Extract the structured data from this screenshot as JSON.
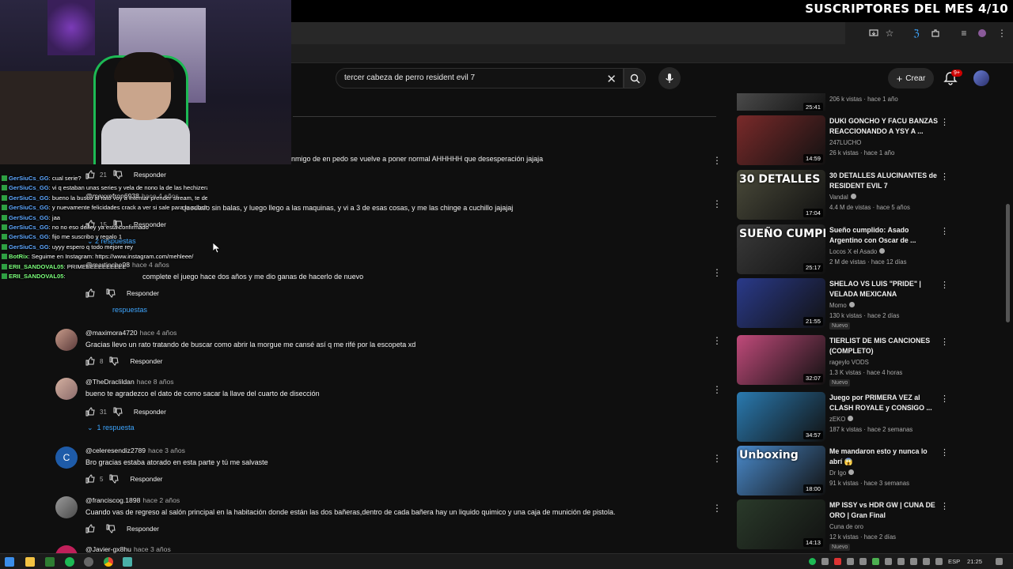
{
  "overlay": {
    "title": "SUSCRIPTORES DEL MES 4/10"
  },
  "search": {
    "query": "tercer cabeza de perro resident evil 7",
    "placeholder": "Buscar"
  },
  "header": {
    "create_label": "Crear",
    "notif_badge": "9+"
  },
  "chat": [
    {
      "user": "GerSiuCs_GG",
      "text": ": cual serie?"
    },
    {
      "user": "GerSiuCs_GG",
      "text": ": vi q estaban unas series y vela de nono la de las hechizeras y la de la n nera"
    },
    {
      "user": "GerSiuCs_GG",
      "text": ": bueno la busco al rato voy a intentar prender stream, te dejo la view"
    },
    {
      "user": "GerSiuCs_GG",
      "text": ": y nuevamente felicidades crack a ver si sale para la subsita"
    },
    {
      "user": "GerSiuCs_GG",
      "text": ": jaa"
    },
    {
      "user": "GerSiuCs_GG",
      "text": ": no no eso de ley ya esta confirmado"
    },
    {
      "user": "GerSiuCs_GG",
      "text": ": fijo me suscribo y regalo 1"
    },
    {
      "user": "GerSiuCs_GG",
      "text": ": uyyy espero q todo mejore rey"
    },
    {
      "user": "BotRix",
      "text": ": Seguime en Instagram: https://www.instagram.com/mehleee/"
    },
    {
      "user": "ERII_SANDOVAL05",
      "text": ": PRIMEEEEEEEEEEE"
    },
    {
      "user": "ERII_SANDOVAL05",
      "text": ":"
    }
  ],
  "comments": [
    {
      "author": "",
      "time": "",
      "text": "nmigo de en pedo se vuelve a poner normal AHHHHH que desesperación jajaja",
      "likes": "21",
      "reply": "Responder"
    },
    {
      "author": "@maxxefron6938",
      "time": "hace 4 años",
      "text": "quedado sin balas, y luego llego a las maquinas, y vi a 3 de esas cosas, y me las chinge a cuchillo jajajaj",
      "likes": "15",
      "reply": "Responder",
      "replies": "2 respuestas"
    },
    {
      "author": "@martincho98",
      "time": "hace 4 años",
      "text": "complete el juego hace dos años y me dio ganas de hacerlo de nuevo",
      "likes": "",
      "reply": "Responder",
      "replies": "respuestas"
    },
    {
      "author": "@maximora4720",
      "time": "hace 4 años",
      "text": "Gracias llevo un rato tratando de buscar como abrir la morgue me cansé así q me rifé por la escopeta xd",
      "likes": "8",
      "reply": "Responder"
    },
    {
      "author": "@TheDraclildan",
      "time": "hace 8 años",
      "text": "bueno te agradezco el dato de como sacar la llave del cuarto de disección",
      "likes": "31",
      "reply": "Responder",
      "replies": "1 respuesta"
    },
    {
      "author": "@celeresendiz2789",
      "time": "hace 3 años",
      "text": "Bro gracias estaba atorado en esta parte y tú me salvaste",
      "likes": "5",
      "reply": "Responder",
      "avatar_letter": "C"
    },
    {
      "author": "@franciscog.1898",
      "time": "hace 2 años",
      "text": "Cuando vas de regreso al salón principal en la habitación donde están las dos bañeras,dentro de cada bañera hay un liquido quimico y una caja de munición de pistola.",
      "likes": "",
      "reply": "Responder"
    },
    {
      "author": "@Javier-gx8hu",
      "time": "hace 3 años",
      "text": "",
      "likes": "",
      "reply": ""
    }
  ],
  "videos": [
    {
      "thumb_label": "",
      "duration": "25:41",
      "title": "",
      "channel": "",
      "meta": "206 k vistas · hace 1 año",
      "is_new": false,
      "color": "#5a5a5a"
    },
    {
      "thumb_label": "",
      "duration": "14:59",
      "title": "DUKI GONCHO Y FACU BANZAS REACCIONANDO A YSY A ...",
      "channel": "247LUCHO",
      "meta": "26 k vistas · hace 1 año",
      "is_new": false,
      "color": "#7a2a2a"
    },
    {
      "thumb_label": "30 DETALLES",
      "duration": "17:04",
      "title": "30 DETALLES ALUCINANTES de RESIDENT EVIL 7",
      "channel": "Vandal",
      "meta": "4.4 M de vistas · hace 5 años",
      "is_new": false,
      "color": "#4a4a3a"
    },
    {
      "thumb_label": "SUEÑO CUMPLI",
      "duration": "25:17",
      "title": "Sueño cumplido: Asado Argentino con Oscar de ...",
      "channel": "Locos X el Asado",
      "meta": "2 M de vistas · hace 12 días",
      "is_new": false,
      "color": "#3a3a3a"
    },
    {
      "thumb_label": "",
      "duration": "21:55",
      "title": "SHELAO VS LUIS \"PRIDE\" | VELADA MEXICANA",
      "channel": "Momo",
      "meta": "130 k vistas · hace 2 días",
      "is_new": true,
      "new_label": "Nuevo",
      "color": "#2a3a8a"
    },
    {
      "thumb_label": "",
      "duration": "32:07",
      "title": "TIERLIST DE MIS CANCIONES (COMPLETO)",
      "channel": "rageylo VODS",
      "meta": "1.3 K vistas · hace 4 horas",
      "is_new": true,
      "new_label": "Nuevo",
      "color": "#c04a7a"
    },
    {
      "thumb_label": "",
      "duration": "34:57",
      "title": "Juego por PRIMERA VEZ al CLASH ROYALE y CONSIGO ...",
      "channel": "zEKO",
      "meta": "187 k vistas · hace 2 semanas",
      "is_new": false,
      "color": "#2a7ab0"
    },
    {
      "thumb_label": "Unboxing",
      "duration": "18:00",
      "title": "Me mandaron esto y nunca lo abrí 😱",
      "channel": "Dr Igo",
      "meta": "91 k vistas · hace 3 semanas",
      "is_new": false,
      "color": "#4a8acb"
    },
    {
      "thumb_label": "",
      "duration": "14:13",
      "title": "MP ISSY vs HDR GW | CUNA DE ORO | Gran Final",
      "channel": "Cuna de oro",
      "meta": "12 k vistas · hace 2 días",
      "is_new": true,
      "new_label": "Nuevo",
      "color": "#2a3a2a"
    }
  ],
  "taskbar": {
    "lang": "ESP",
    "time": "21:25"
  }
}
